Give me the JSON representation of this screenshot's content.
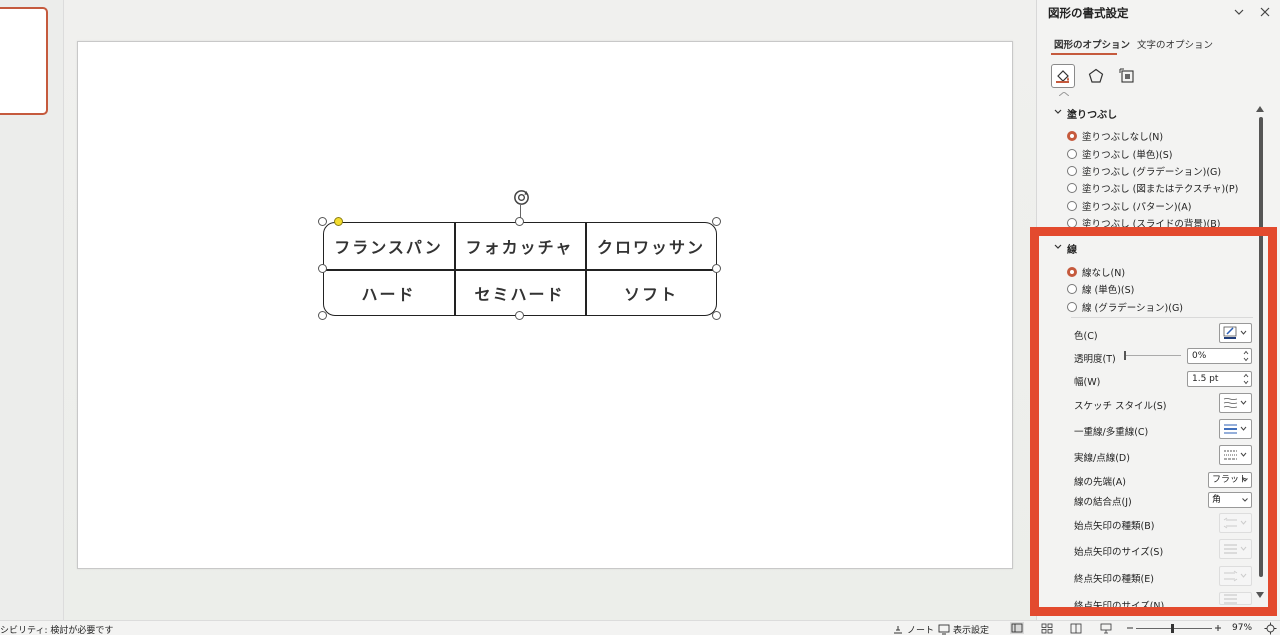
{
  "slide_table": {
    "row1": [
      "フランスパン",
      "フォカッチャ",
      "クロワッサン"
    ],
    "row2": [
      "ハード",
      "セミハード",
      "ソフト"
    ]
  },
  "pane": {
    "title": "図形の書式設定",
    "tabs": [
      "図形のオプション",
      "文字のオプション"
    ],
    "fill_section": {
      "title": "塗りつぶし",
      "options": [
        "塗りつぶしなし(N)",
        "塗りつぶし (単色)(S)",
        "塗りつぶし (グラデーション)(G)",
        "塗りつぶし (図またはテクスチャ)(P)",
        "塗りつぶし (パターン)(A)",
        "塗りつぶし (スライドの背景)(B)"
      ],
      "selected": 0
    },
    "line_section": {
      "title": "線",
      "options": [
        "線なし(N)",
        "線 (単色)(S)",
        "線 (グラデーション)(G)"
      ],
      "selected": 0,
      "labels": {
        "color": "色(C)",
        "transparency": "透明度(T)",
        "width": "幅(W)",
        "sketch": "スケッチ スタイル(S)",
        "compound": "一重線/多重線(C)",
        "dash": "実線/点線(D)",
        "cap": "線の先端(A)",
        "join": "線の結合点(J)",
        "begin_arrow_type": "始点矢印の種類(B)",
        "begin_arrow_size": "始点矢印のサイズ(S)",
        "end_arrow_type": "終点矢印の種類(E)",
        "end_arrow_size": "終点矢印のサイズ(N)"
      },
      "values": {
        "transparency": "0%",
        "width": "1.5 pt",
        "cap": "フラット",
        "join": "角"
      }
    }
  },
  "status": {
    "accessibility": "シビリティ: 検討が必要です",
    "notes": "ノート",
    "display_settings": "表示設定",
    "zoom": "97%"
  },
  "colors": {
    "accent": "#c55a3d",
    "highlight": "#e34a2e"
  }
}
